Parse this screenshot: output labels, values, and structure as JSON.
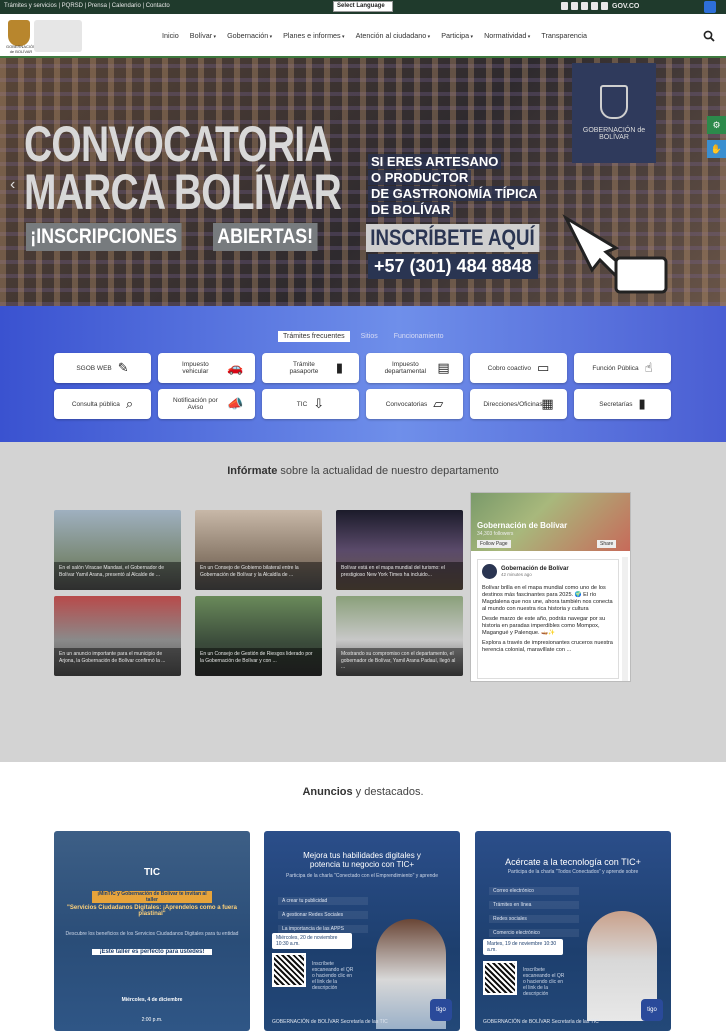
{
  "topbar": {
    "links": "Trámites y servicios | PQRSD | Prensa | Calendario | Contacto",
    "language": "Select Language",
    "govco": "GOV.CO"
  },
  "header": {
    "logo_label": "GOBERNACIÓN de BOLÍVAR",
    "menu": [
      "Inicio",
      "Bolívar",
      "Gobernación",
      "Planes e informes",
      "Atención al ciudadano",
      "Participa",
      "Normatividad",
      "Transparencia"
    ],
    "menu_has_caret": [
      false,
      true,
      true,
      true,
      true,
      true,
      true,
      false
    ]
  },
  "hero": {
    "title_line1": "CONVOCATORIA",
    "title_line2": "MARCA BOLÍVAR",
    "insc_a": "¡INSCRIPCIONES",
    "insc_b": "ABIERTAS!",
    "artesano": [
      "SI ERES ARTESANO",
      "O PRODUCTOR",
      "DE GASTRONOMÍA TÍPICA",
      "DE BOLÍVAR"
    ],
    "cta": "INSCRÍBETE AQUÍ",
    "phone": "+57 (301) 484 8848",
    "badge": "GOBERNACIÓN de BOLÍVAR"
  },
  "quick": {
    "tabs": [
      "Trámites frecuentes",
      "Sitios",
      "Funcionamiento"
    ],
    "buttons": [
      {
        "label": "SGOB WEB",
        "icon": "✎"
      },
      {
        "label": "Impuesto vehicular",
        "icon": "🚗"
      },
      {
        "label": "Trámite pasaporte",
        "icon": "▮"
      },
      {
        "label": "Impuesto departamental",
        "icon": "▤"
      },
      {
        "label": "Cobro coactivo",
        "icon": "▭"
      },
      {
        "label": "Función Pública",
        "icon": "☝"
      },
      {
        "label": "Consulta pública",
        "icon": "⌕"
      },
      {
        "label": "Notificación por Aviso",
        "icon": "📣"
      },
      {
        "label": "TIC",
        "icon": "⇩"
      },
      {
        "label": "Convocatorias",
        "icon": "▱"
      },
      {
        "label": "Direcciones/Oficinas",
        "icon": "▦"
      },
      {
        "label": "Secretarías",
        "icon": "▮"
      }
    ]
  },
  "news": {
    "heading_bold": "Infórmate",
    "heading_rest": " sobre la actualidad de nuestro departamento",
    "cards": [
      "En el salón Viracae Mandasi, el Gobernador de Bolívar Yamil Arana, presentó al Alcalde de ...",
      "En un Consejo de Gobierno bilateral entre la Gobernación de Bolívar y la Alcaldía de ...",
      "Bolívar está en el mapa mundial del turismo: el prestigioso New York Times ha incluido...",
      "En un anuncio importante para el municipio de Arjona, la Gobernación de Bolívar confirmó la ...",
      "En un Consejo de Gestión de Riesgos liderado por la Gobernación de Bolívar y con ...",
      "Mostrando su compromiso con el departamento, el gobernador de Bolívar, Yamil Arana Padauí, llegó al ..."
    ],
    "fb": {
      "page_name": "Gobernación de Bolívar",
      "followers": "34,303 followers",
      "follow": "Follow Page",
      "share": "Share",
      "post_name": "Gobernación de Bolívar",
      "post_time": "42 minutes ago",
      "post_p1": "Bolívar brilla en el mapa mundial como uno de los destinos más fascinantes para 2025. 🌍 El río Magdalena que nos une, ahora también nos conecta al mundo con nuestra rica historia y cultura",
      "post_p2": "Desde marzo de este año, podrás navegar por su historia en paradas imperdibles como Mompox, Magangué y Palenque. 🛶✨",
      "post_p3": "Explora a través de impresionantes cruceros nuestra herencia colonial, maravíllate con ..."
    }
  },
  "announcements": {
    "heading_bold": "Anuncios",
    "heading_rest": " y destacados.",
    "p1": {
      "t1": "¡MinTIC y Gobernación de Bolívar te invitan al taller",
      "t2": "\"Servicios Ciudadanos Digitales: ¡Aprendelos como a fuera plastinal\"",
      "t3": "Descubre los beneficios de los Servicios Ciudadanos Digitales para tu entidad",
      "t4": "¡Este taller es perfecto para ustedes!",
      "date": "Miércoles, 4 de diciembre",
      "time": "2:00 p.m."
    },
    "p2": {
      "t1": "Mejora tus habilidades digitales y potencia tu negocio con TIC+",
      "t2": "Participa de la charla \"Conectado con el Emprendimiento\" y aprende",
      "rows": [
        "A crear tu publicidad",
        "A gestionar Redes Sociales",
        "La importancia de las APPS"
      ],
      "date": "Miércoles, 20 de noviembre 10:30 a.m.",
      "qr_text": "Inscríbete escaneando el QR o haciendo clic en el link de la descripción",
      "foot": "GOBERNACIÓN de BOLÍVAR  Secretaría de las TIC"
    },
    "p3": {
      "t1": "Acércate a la tecnología con TIC+",
      "t2": "Participa de la charla \"Todos Conectados\" y aprende sobre",
      "rows": [
        "Correo electrónico",
        "Trámites en línea",
        "Redes sociales",
        "Comercio electrónico"
      ],
      "date": "Martes, 19 de noviembre 10:30 a.m.",
      "qr_text": "Inscríbete escaneando el QR o haciendo clic en el link de la descripción",
      "foot": "GOBERNACIÓN de BOLÍVAR  Secretaría de las TIC"
    }
  },
  "colors": {
    "topbar": "#1f3a2c",
    "nav_accent": "#3f7a3f",
    "quick_bg": "#4a62d8",
    "news_bg": "#d3d3d3",
    "poster_blue": "#1d3f6e"
  }
}
